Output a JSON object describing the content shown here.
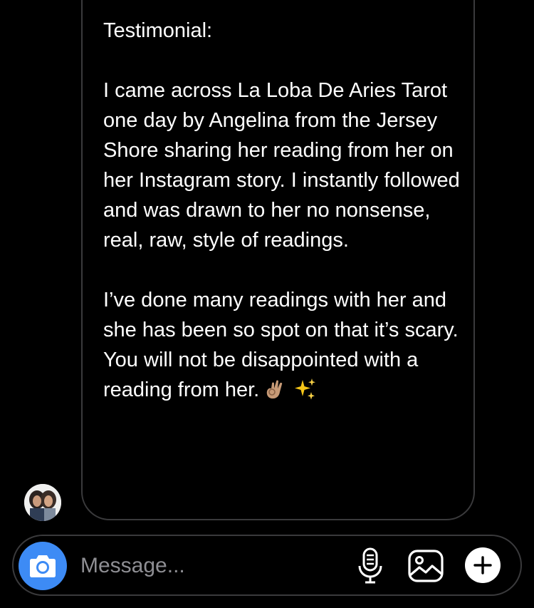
{
  "message": {
    "title": "Testimonial:",
    "paragraph_1": "I came across La Loba De Aries Tarot one day by Angelina from the Jersey Shore sharing her reading from her on her Instagram story. I instantly followed and was drawn to her no nonsense, real, raw, style of readings.",
    "paragraph_2": "I’ve done many readings with her and she has been so spot on that it’s scary. You will not be disappointed with a reading from her.",
    "emojis": [
      "ok-hand-emoji",
      "sparkles-emoji"
    ]
  },
  "sender": {
    "avatar": "avatar-photo"
  },
  "composer": {
    "placeholder": "Message...",
    "value": "",
    "icons": [
      "camera-icon",
      "microphone-icon",
      "gallery-icon",
      "plus-icon"
    ],
    "accent_color": "#3d8bf5"
  },
  "colors": {
    "background": "#000000",
    "bubble_border": "#3a3a3c",
    "text": "#ffffff",
    "placeholder": "#8e8e93"
  }
}
